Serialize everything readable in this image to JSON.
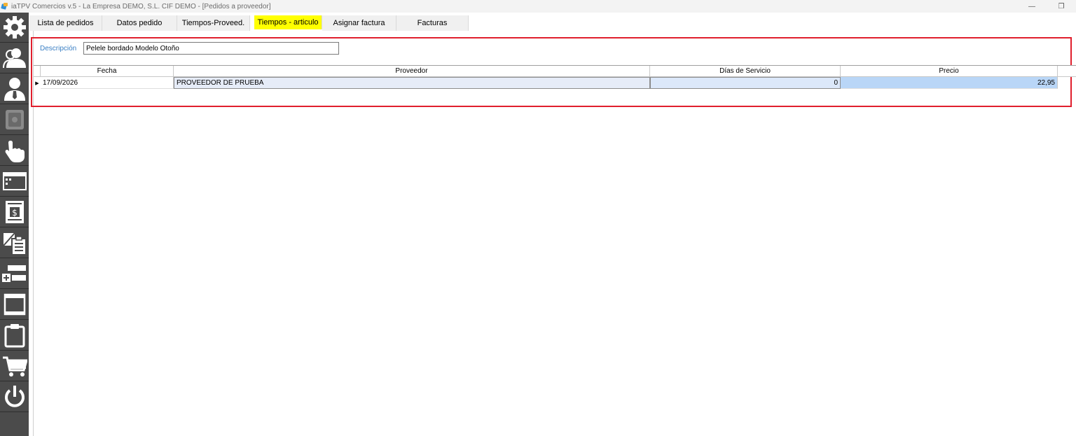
{
  "window": {
    "title": "iaTPV Comercios v.5 - La Empresa DEMO, S.L. CIF DEMO - [Pedidos a proveedor]",
    "minimize_glyph": "—",
    "restore_glyph": "❐"
  },
  "sidebar": {
    "items": [
      {
        "icon": "gear-icon"
      },
      {
        "icon": "users-icon"
      },
      {
        "icon": "user-tie-icon"
      },
      {
        "icon": "safe-icon"
      },
      {
        "icon": "hand-pointer-icon"
      },
      {
        "icon": "window-icon"
      },
      {
        "icon": "invoice-dollar-icon"
      },
      {
        "icon": "copy-clipboard-icon"
      },
      {
        "icon": "add-row-icon"
      },
      {
        "icon": "document-list-icon"
      },
      {
        "icon": "clipboard-icon"
      },
      {
        "icon": "cart-icon"
      },
      {
        "icon": "power-icon"
      }
    ]
  },
  "tabs": [
    {
      "label": "Lista de pedidos",
      "active": false
    },
    {
      "label": "Datos pedido",
      "active": false
    },
    {
      "label": "Tiempos-Proveed.",
      "active": false
    },
    {
      "label": "Tiempos - articulo",
      "active": true
    },
    {
      "label": "Asignar factura",
      "active": false
    },
    {
      "label": "Facturas",
      "active": false
    }
  ],
  "form": {
    "description_label": "Descripción",
    "description_value": "Pelele bordado Modelo Otoño"
  },
  "grid": {
    "columns": [
      "Fecha",
      "Proveedor",
      "Días de Servicio",
      "Precio"
    ],
    "rows": [
      {
        "fecha": "17/09/2026",
        "proveedor": "PROVEEDOR DE PRUEBA",
        "dias": "0",
        "precio": "22,95"
      }
    ]
  },
  "colors": {
    "active_tab": "#ffff00",
    "highlight_border": "#e01f2d",
    "sidebar_bg": "#4b4b4b",
    "label_blue": "#3a7fc4"
  }
}
